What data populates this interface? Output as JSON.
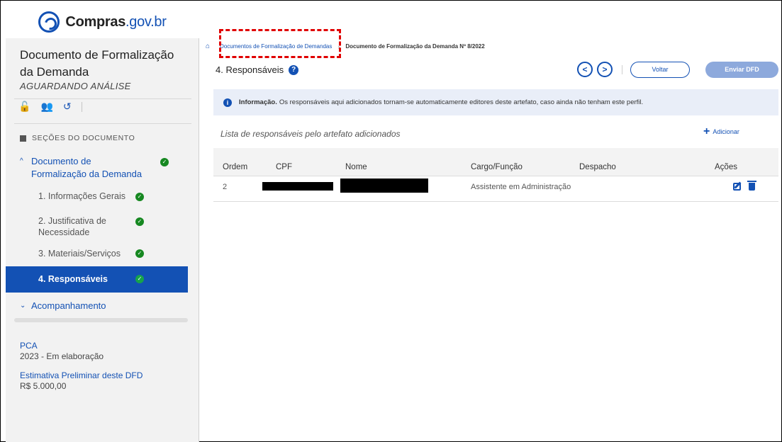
{
  "logo": {
    "brand_main": "Compras",
    "brand_suffix": ".gov.br"
  },
  "sidebar": {
    "doc_title": "Documento de Formalização da Demanda",
    "status": "AGUARDANDO ANÁLISE",
    "sections_title": "SEÇÕES DO DOCUMENTO",
    "group_main": "Documento de Formalização da Demanda",
    "items": [
      {
        "label": "1. Informações Gerais"
      },
      {
        "label": "2. Justificativa de Necessidade"
      },
      {
        "label": "3. Materiais/Serviços"
      },
      {
        "label": "4. Responsáveis"
      }
    ],
    "group_follow": "Acompanhamento",
    "pca_label": "PCA",
    "pca_value": "2023 - Em elaboração",
    "estimate_label": "Estimativa Preliminar deste DFD",
    "estimate_value": "R$ 5.000,00"
  },
  "breadcrumb": {
    "link": "Documentos de Formalização de Demandas",
    "current": "Documento de Formalização da Demanda Nº 8/2022"
  },
  "header": {
    "section_title": "4. Responsáveis",
    "back_label": "Voltar",
    "send_label": "Enviar DFD"
  },
  "info": {
    "title": "Informação.",
    "text": "Os responsáveis aqui adicionados tornam-se automaticamente editores deste artefato, caso ainda não tenham este perfil."
  },
  "list": {
    "title": "Lista de responsáveis pelo artefato adicionados",
    "add_label": "Adicionar",
    "columns": {
      "ordem": "Ordem",
      "cpf": "CPF",
      "nome": "Nome",
      "cargo": "Cargo/Função",
      "despacho": "Despacho",
      "acoes": "Ações"
    },
    "rows": [
      {
        "ordem": "2",
        "cargo": "Assistente em Administração"
      }
    ]
  },
  "colors": {
    "primary": "#1351b4",
    "success": "#168821",
    "info_bg": "#e9eef8",
    "highlight": "#e00000"
  }
}
